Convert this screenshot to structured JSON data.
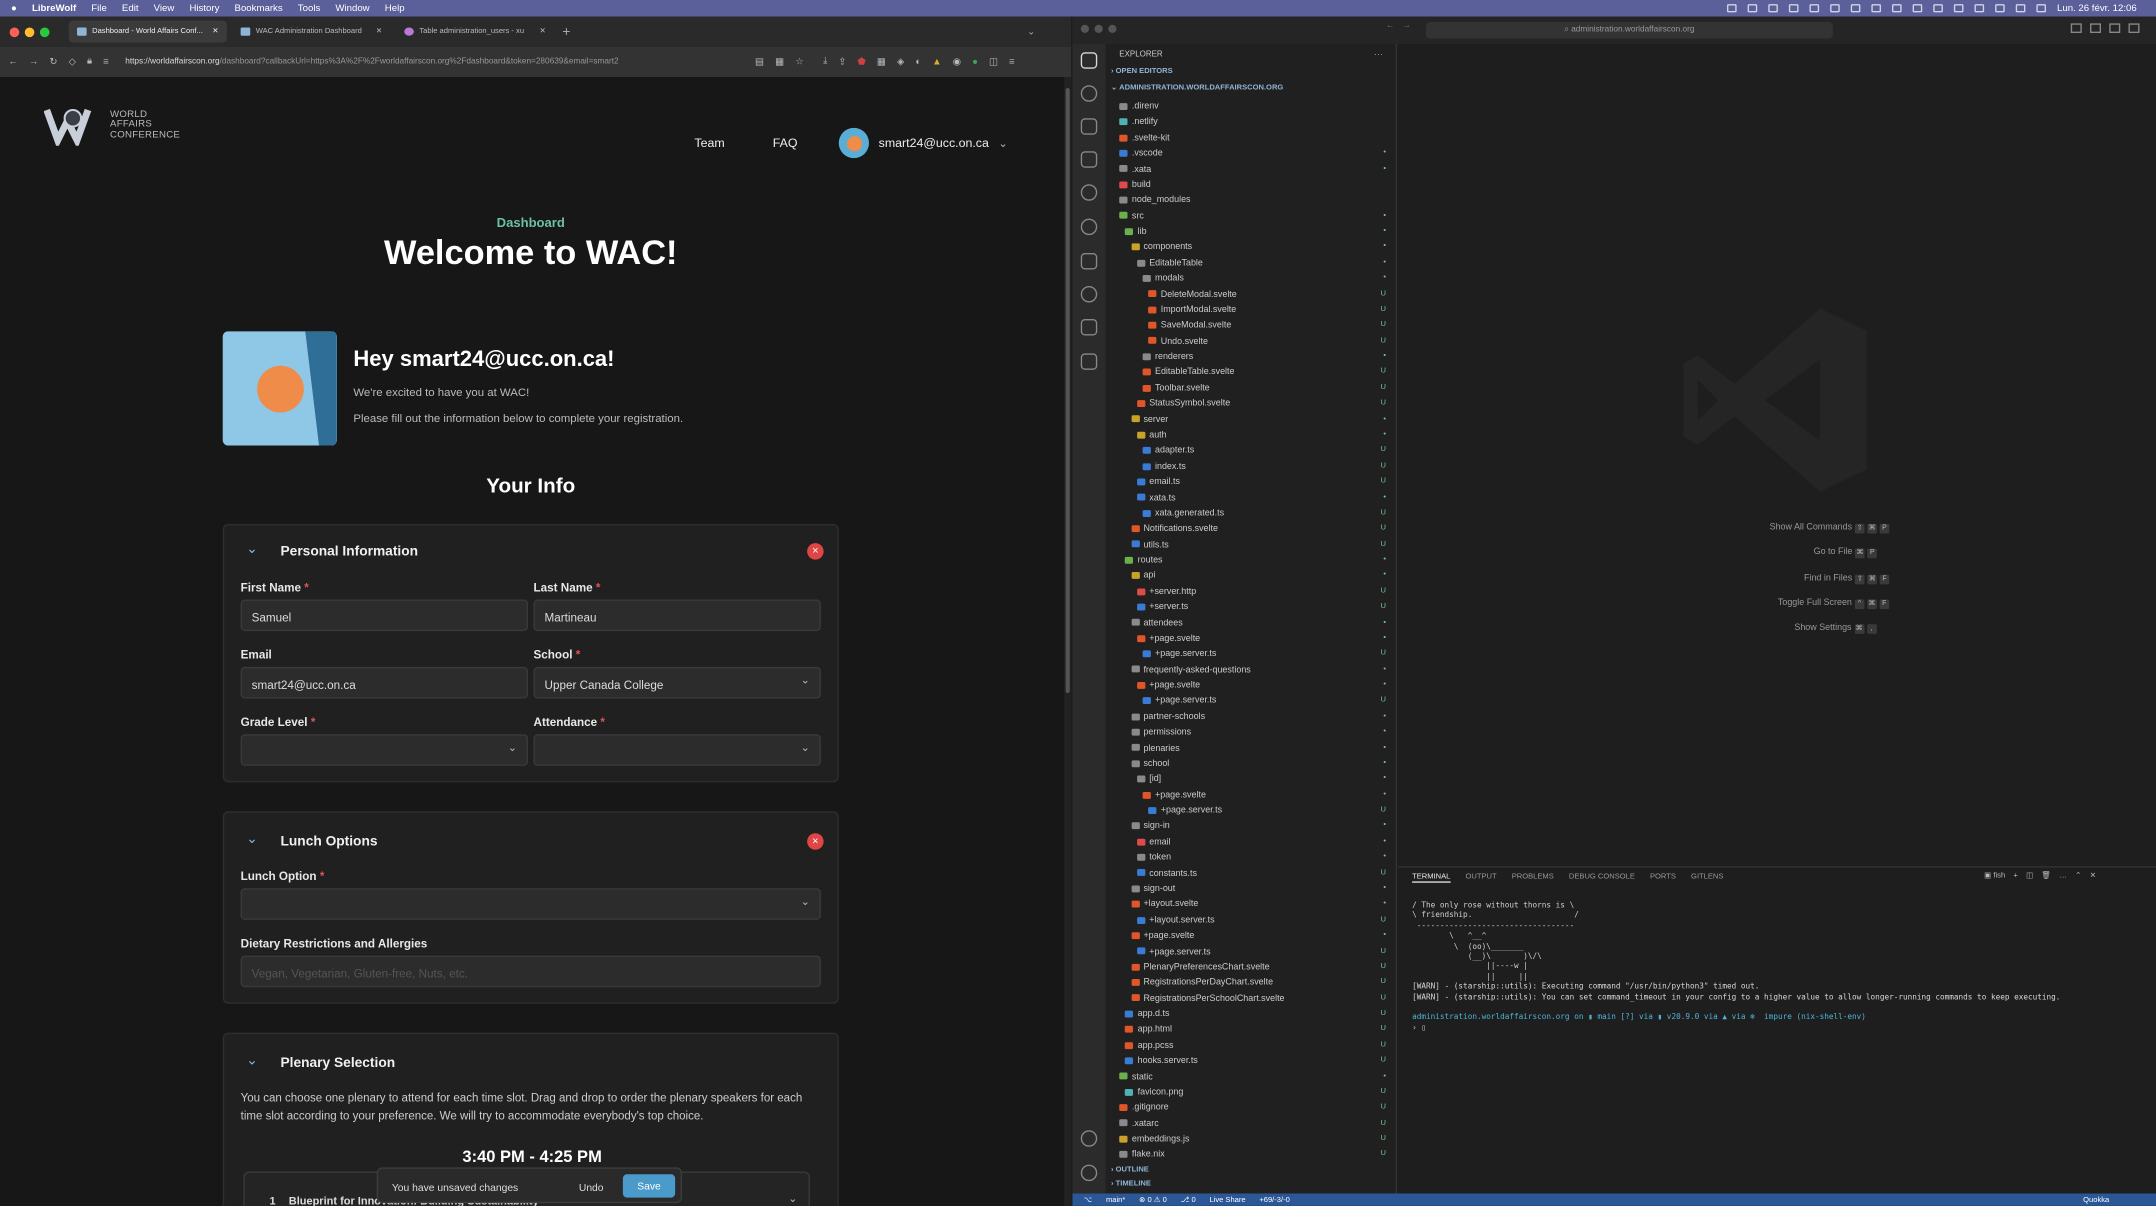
{
  "menubar": {
    "app": "LibreWolf",
    "items": [
      "File",
      "Edit",
      "View",
      "History",
      "Bookmarks",
      "Tools",
      "Window",
      "Help"
    ],
    "clock": "Lun. 26 févr. 12:06",
    "quokka": "Quokka"
  },
  "browser": {
    "tabs": [
      "Dashboard - World Affairs Conf...",
      "WAC Administration Dashboard",
      "Table administration_users - xu"
    ],
    "url_host": "https://worldaffairscon.org",
    "url_path": "/dashboard?callbackUrl=https%3A%2F%2Fworldaffairscon.org%2Fdashboard&token=280639&email=smart2"
  },
  "site": {
    "logo": [
      "WORLD",
      "AFFAIRS",
      "CONFERENCE"
    ],
    "nav": {
      "team": "Team",
      "faq": "FAQ",
      "user": "smart24@ucc.on.ca"
    },
    "eyebrow": "Dashboard",
    "heading": "Welcome to WAC!",
    "greeting": "Hey smart24@ucc.on.ca!",
    "line1": "We're excited to have you at WAC!",
    "line2": "Please fill out the information below to complete your registration.",
    "your_info": "Your Info",
    "personal": {
      "title": "Personal Information",
      "first_label": "First Name",
      "first": "Samuel",
      "last_label": "Last Name",
      "last": "Martineau",
      "email_label": "Email",
      "email": "smart24@ucc.on.ca",
      "school_label": "School",
      "school": "Upper Canada College",
      "grade_label": "Grade Level",
      "attendance_label": "Attendance"
    },
    "lunch": {
      "title": "Lunch Options",
      "option_label": "Lunch Option",
      "diet_label": "Dietary Restrictions and Allergies",
      "diet_placeholder": "Vegan, Vegetarian, Gluten-free, Nuts, etc."
    },
    "plenary": {
      "title": "Plenary Selection",
      "desc": "You can choose one plenary to attend for each time slot. Drag and drop to order the plenary speakers for each time slot according to your preference. We will try to accommodate everybody's top choice.",
      "time": "3:40 PM - 4:25 PM",
      "item_num": "1",
      "item": "Blueprint for Innovation: Building Sustainability"
    },
    "toast": {
      "msg": "You have unsaved changes",
      "undo": "Undo",
      "save": "Save"
    }
  },
  "vscode": {
    "search": "administration.worldaffairscon.org",
    "explorer": "EXPLORER",
    "open_editors": "OPEN EDITORS",
    "root": "ADMINISTRATION.WORLDAFFAIRSCON.ORG",
    "tree": [
      {
        "n": ".direnv",
        "d": 1,
        "c": "#8a8a8a",
        "s": ""
      },
      {
        "n": ".netlify",
        "d": 1,
        "c": "#4fb3b3",
        "s": ""
      },
      {
        "n": ".svelte-kit",
        "d": 1,
        "c": "#e0552a",
        "s": ""
      },
      {
        "n": ".vscode",
        "d": 1,
        "c": "#3a7bd5",
        "s": "•"
      },
      {
        "n": ".xata",
        "d": 1,
        "c": "#8a8a8a",
        "s": "•"
      },
      {
        "n": "build",
        "d": 1,
        "c": "#e04a4a",
        "s": ""
      },
      {
        "n": "node_modules",
        "d": 1,
        "c": "#8a8a8a",
        "s": ""
      },
      {
        "n": "src",
        "d": 1,
        "c": "#6ab04c",
        "s": "•"
      },
      {
        "n": "lib",
        "d": 2,
        "c": "#6ab04c",
        "s": "•"
      },
      {
        "n": "components",
        "d": 3,
        "c": "#c9a227",
        "s": "•"
      },
      {
        "n": "EditableTable",
        "d": 4,
        "c": "#8a8a8a",
        "s": "•"
      },
      {
        "n": "modals",
        "d": 5,
        "c": "#8a8a8a",
        "s": "•"
      },
      {
        "n": "DeleteModal.svelte",
        "d": 6,
        "c": "#e0552a",
        "s": "U"
      },
      {
        "n": "ImportModal.svelte",
        "d": 6,
        "c": "#e0552a",
        "s": "U"
      },
      {
        "n": "SaveModal.svelte",
        "d": 6,
        "c": "#e0552a",
        "s": "U"
      },
      {
        "n": "Undo.svelte",
        "d": 6,
        "c": "#e0552a",
        "s": "U"
      },
      {
        "n": "renderers",
        "d": 5,
        "c": "#8a8a8a",
        "s": "•"
      },
      {
        "n": "EditableTable.svelte",
        "d": 5,
        "c": "#e0552a",
        "s": "U"
      },
      {
        "n": "Toolbar.svelte",
        "d": 5,
        "c": "#e0552a",
        "s": "U"
      },
      {
        "n": "StatusSymbol.svelte",
        "d": 4,
        "c": "#e0552a",
        "s": "U"
      },
      {
        "n": "server",
        "d": 3,
        "c": "#c9a227",
        "s": "•"
      },
      {
        "n": "auth",
        "d": 4,
        "c": "#c9a227",
        "s": "•"
      },
      {
        "n": "adapter.ts",
        "d": 5,
        "c": "#3a7bd5",
        "s": "U"
      },
      {
        "n": "index.ts",
        "d": 5,
        "c": "#3a7bd5",
        "s": "U"
      },
      {
        "n": "email.ts",
        "d": 4,
        "c": "#3a7bd5",
        "s": "U"
      },
      {
        "n": "xata.ts",
        "d": 4,
        "c": "#3a7bd5",
        "s": "•"
      },
      {
        "n": "xata.generated.ts",
        "d": 5,
        "c": "#3a7bd5",
        "s": "U"
      },
      {
        "n": "Notifications.svelte",
        "d": 3,
        "c": "#e0552a",
        "s": "U"
      },
      {
        "n": "utils.ts",
        "d": 3,
        "c": "#3a7bd5",
        "s": "U"
      },
      {
        "n": "routes",
        "d": 2,
        "c": "#6ab04c",
        "s": "•"
      },
      {
        "n": "api",
        "d": 3,
        "c": "#c9a227",
        "s": "•"
      },
      {
        "n": "+server.http",
        "d": 4,
        "c": "#e04a4a",
        "s": "U"
      },
      {
        "n": "+server.ts",
        "d": 4,
        "c": "#3a7bd5",
        "s": "U"
      },
      {
        "n": "attendees",
        "d": 3,
        "c": "#8a8a8a",
        "s": "•"
      },
      {
        "n": "+page.svelte",
        "d": 4,
        "c": "#e0552a",
        "s": "•"
      },
      {
        "n": "+page.server.ts",
        "d": 5,
        "c": "#3a7bd5",
        "s": "U"
      },
      {
        "n": "frequently-asked-questions",
        "d": 3,
        "c": "#8a8a8a",
        "s": "•"
      },
      {
        "n": "+page.svelte",
        "d": 4,
        "c": "#e0552a",
        "s": "•"
      },
      {
        "n": "+page.server.ts",
        "d": 5,
        "c": "#3a7bd5",
        "s": "U"
      },
      {
        "n": "partner-schools",
        "d": 3,
        "c": "#8a8a8a",
        "s": "•"
      },
      {
        "n": "permissions",
        "d": 3,
        "c": "#8a8a8a",
        "s": "•"
      },
      {
        "n": "plenaries",
        "d": 3,
        "c": "#8a8a8a",
        "s": "•"
      },
      {
        "n": "school",
        "d": 3,
        "c": "#8a8a8a",
        "s": "•"
      },
      {
        "n": "[id]",
        "d": 4,
        "c": "#8a8a8a",
        "s": "•"
      },
      {
        "n": "+page.svelte",
        "d": 5,
        "c": "#e0552a",
        "s": "•"
      },
      {
        "n": "+page.server.ts",
        "d": 6,
        "c": "#3a7bd5",
        "s": "U"
      },
      {
        "n": "sign-in",
        "d": 3,
        "c": "#8a8a8a",
        "s": "•"
      },
      {
        "n": "email",
        "d": 4,
        "c": "#e04a4a",
        "s": "•"
      },
      {
        "n": "token",
        "d": 4,
        "c": "#8a8a8a",
        "s": "•"
      },
      {
        "n": "constants.ts",
        "d": 4,
        "c": "#3a7bd5",
        "s": "U"
      },
      {
        "n": "sign-out",
        "d": 3,
        "c": "#8a8a8a",
        "s": "•"
      },
      {
        "n": "+layout.svelte",
        "d": 3,
        "c": "#e0552a",
        "s": "•"
      },
      {
        "n": "+layout.server.ts",
        "d": 4,
        "c": "#3a7bd5",
        "s": "U"
      },
      {
        "n": "+page.svelte",
        "d": 3,
        "c": "#e0552a",
        "s": "•"
      },
      {
        "n": "+page.server.ts",
        "d": 4,
        "c": "#3a7bd5",
        "s": "U"
      },
      {
        "n": "PlenaryPreferencesChart.svelte",
        "d": 3,
        "c": "#e0552a",
        "s": "U"
      },
      {
        "n": "RegistrationsPerDayChart.svelte",
        "d": 3,
        "c": "#e0552a",
        "s": "U"
      },
      {
        "n": "RegistrationsPerSchoolChart.svelte",
        "d": 3,
        "c": "#e0552a",
        "s": "U"
      },
      {
        "n": "app.d.ts",
        "d": 2,
        "c": "#3a7bd5",
        "s": "U"
      },
      {
        "n": "app.html",
        "d": 2,
        "c": "#e0552a",
        "s": "U"
      },
      {
        "n": "app.pcss",
        "d": 2,
        "c": "#e0552a",
        "s": "U"
      },
      {
        "n": "hooks.server.ts",
        "d": 2,
        "c": "#3a7bd5",
        "s": "U"
      },
      {
        "n": "static",
        "d": 1,
        "c": "#6ab04c",
        "s": "•"
      },
      {
        "n": "favicon.png",
        "d": 2,
        "c": "#4fb3b3",
        "s": "U"
      },
      {
        "n": ".gitignore",
        "d": 1,
        "c": "#e0552a",
        "s": "U"
      },
      {
        "n": ".xatarc",
        "d": 1,
        "c": "#8a8a8a",
        "s": "U"
      },
      {
        "n": "embeddings.js",
        "d": 1,
        "c": "#c9a227",
        "s": "U"
      },
      {
        "n": "flake.nix",
        "d": 1,
        "c": "#8a8a8a",
        "s": "U"
      }
    ],
    "outline": "OUTLINE",
    "timeline": "TIMELINE",
    "commands": [
      {
        "l": "Show All Commands",
        "k": "⇧ ⌘ P"
      },
      {
        "l": "Go to File",
        "k": "⌘ P"
      },
      {
        "l": "Find in Files",
        "k": "⇧ ⌘ F"
      },
      {
        "l": "Toggle Full Screen",
        "k": "^ ⌘ F"
      },
      {
        "l": "Show Settings",
        "k": "⌘ ,"
      }
    ],
    "panel_tabs": [
      "TERMINAL",
      "OUTPUT",
      "PROBLEMS",
      "DEBUG CONSOLE",
      "PORTS",
      "GITLENS"
    ],
    "shell": "fish",
    "terminal": [
      "/ The only rose without thorns is \\",
      "\\ friendship.                      /",
      " ----------------------------------",
      "        \\   ^__^",
      "         \\  (oo)\\_______",
      "            (__)\\       )\\/\\",
      "                ||----w |",
      "                ||     ||",
      "[WARN] - (starship::utils): Executing command \"/usr/bin/python3\" timed out.",
      "[WARN] - (starship::utils): You can set command_timeout in your config to a higher value to allow longer-running commands to keep executing.",
      "",
      "administration.worldaffairscon.org on ▮ main [?] via ▮ v20.9.0 via ▲ via ❄  impure (nix-shell-env)",
      "› ▯"
    ],
    "status": {
      "branch": "main*",
      "errors": "⊗ 0 ⚠ 0",
      "ports": "⎇ 0",
      "live": "Live Share",
      "diff": "+69/-3/-0"
    }
  }
}
